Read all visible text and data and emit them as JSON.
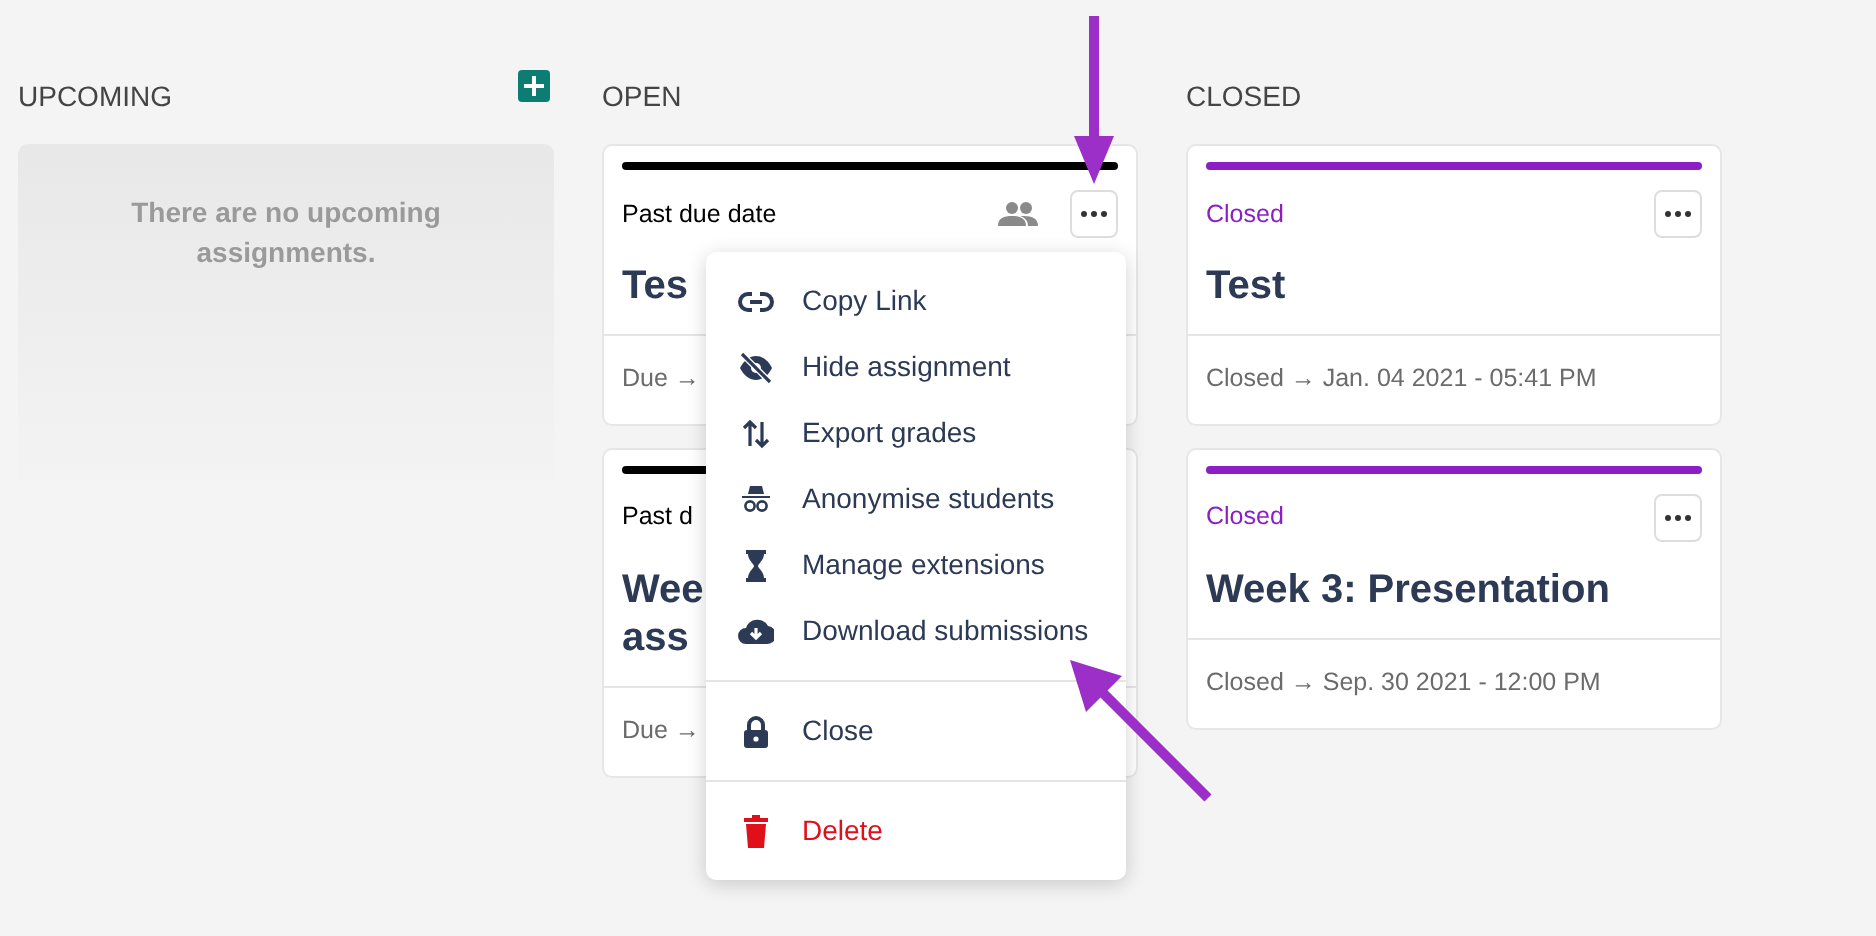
{
  "columns": [
    {
      "heading": "UPCOMING",
      "add_button": true,
      "empty_text": "There are no upcoming assignments."
    },
    {
      "heading": "OPEN",
      "cards": [
        {
          "status": "Past due date",
          "color": "#000000",
          "shared": true,
          "menu_button": true,
          "title_lines": [
            "Tes"
          ],
          "footer": "Due →"
        },
        {
          "status": "Past d",
          "color": "#000000",
          "title_lines": [
            "Wee",
            "ass"
          ],
          "footer": "Due →"
        }
      ]
    },
    {
      "heading": "CLOSED",
      "cards": [
        {
          "status": "Closed",
          "color": "#8b1fc4",
          "menu_button": true,
          "title_lines": [
            "Test"
          ],
          "footer": "Closed → Jan. 04 2021 - 05:41 PM"
        },
        {
          "status": "Closed",
          "color": "#8b1fc4",
          "menu_button": true,
          "title_lines": [
            "Week 3: Presentation"
          ],
          "footer": "Closed → Sep. 30 2021 - 12:00 PM"
        }
      ]
    }
  ],
  "menu": {
    "groups": [
      [
        {
          "label": "Copy Link",
          "kind": "action"
        },
        {
          "label": "Hide assignment",
          "kind": "action"
        },
        {
          "label": "Export grades",
          "kind": "action"
        },
        {
          "label": "Anonymise students",
          "kind": "action"
        },
        {
          "label": "Manage extensions",
          "kind": "action"
        },
        {
          "label": "Download submissions",
          "kind": "action"
        }
      ],
      [
        {
          "label": "Close",
          "kind": "action"
        }
      ],
      [
        {
          "label": "Delete",
          "kind": "danger"
        }
      ]
    ]
  }
}
